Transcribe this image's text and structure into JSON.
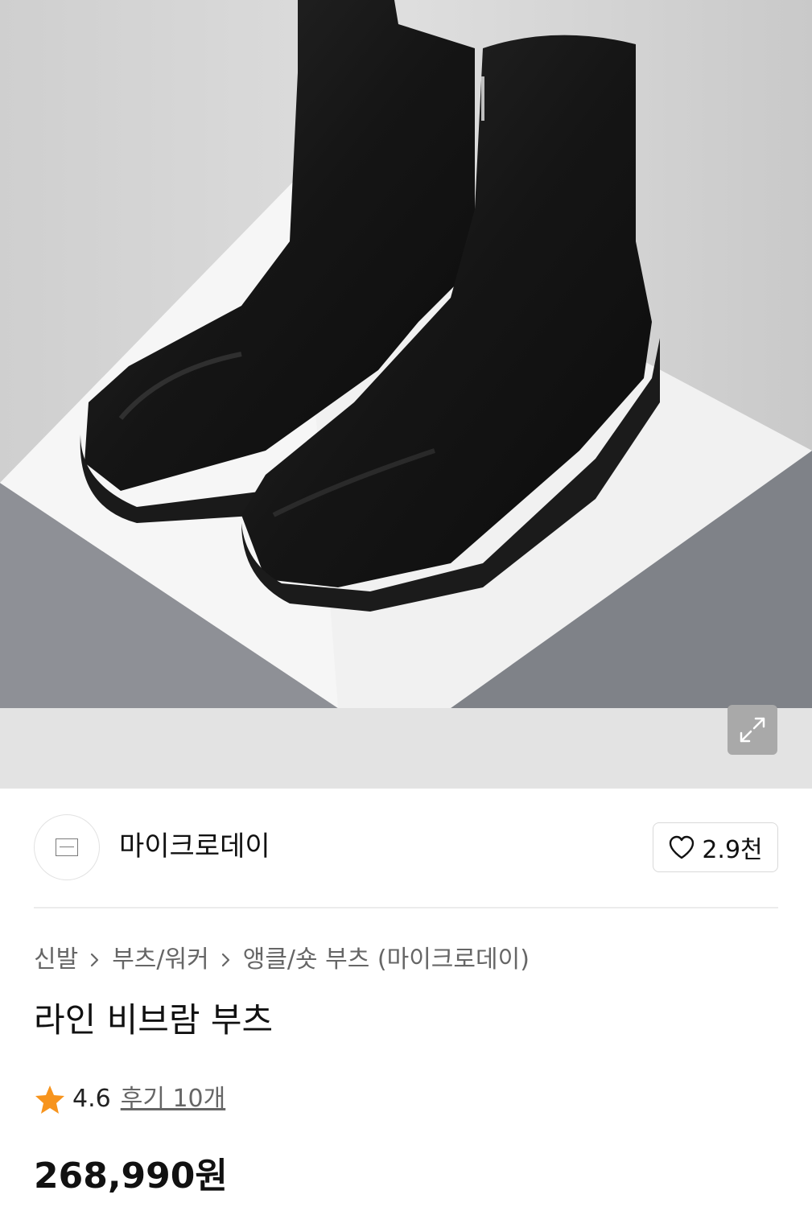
{
  "product_image": {
    "alt": "",
    "expand_button": "expand-icon"
  },
  "brand": {
    "name": "마이크로데이",
    "like_count": "2.9천",
    "like_icon": "heart-icon"
  },
  "breadcrumb": {
    "items": [
      "신발",
      "부츠/워커",
      "앵클/숏 부츠 (마이크로데이)"
    ],
    "separator_icon": "chevron-right-icon"
  },
  "product": {
    "title": "라인 비브람 부츠",
    "rating": "4.6",
    "review_link": "후기 10개",
    "price": "268,990원"
  },
  "colors": {
    "star": "#f7941d",
    "text_primary": "#111111",
    "text_secondary": "#666666",
    "divider": "#ececec"
  }
}
